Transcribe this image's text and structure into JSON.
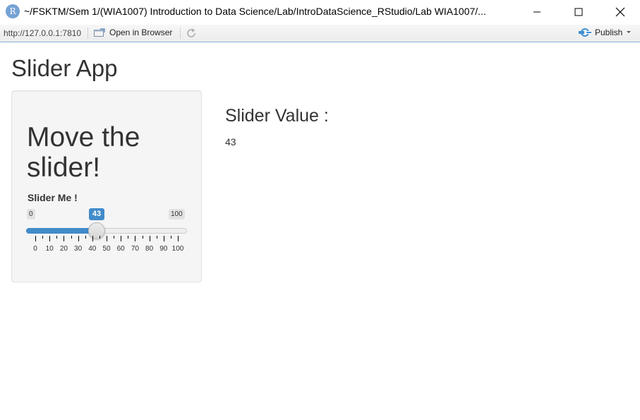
{
  "window": {
    "app_icon_letter": "R",
    "title": "~/FSKTM/Sem 1/(WIA1007) Introduction to Data Science/Lab/IntroDataScience_RStudio/Lab WIA1007/..."
  },
  "toolbar": {
    "url": "http://127.0.0.1:7810",
    "open_in_browser": "Open in Browser",
    "publish": "Publish"
  },
  "app": {
    "title": "Slider App",
    "sidebar_heading": "Move the slider!",
    "slider": {
      "label": "Slider Me !",
      "min": 0,
      "max": 100,
      "value": 43,
      "min_label": "0",
      "max_label": "100",
      "value_label": "43",
      "tick_labels": [
        "0",
        "10",
        "20",
        "30",
        "40",
        "50",
        "60",
        "70",
        "80",
        "90",
        "100"
      ]
    },
    "output_heading": "Slider Value :",
    "output_value": "43"
  },
  "colors": {
    "accent": "#428bca",
    "toolbar_border": "#8db2d8",
    "r_icon": "#75a2d4",
    "publish_icon": "#3b8fd4"
  }
}
